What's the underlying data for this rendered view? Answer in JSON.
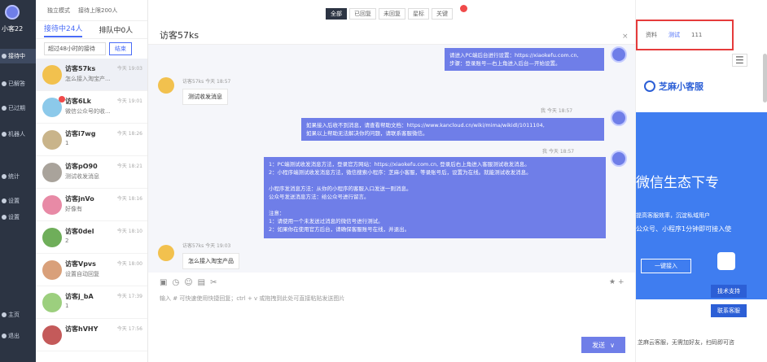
{
  "nav": {
    "user": "小客22",
    "items": [
      {
        "label": "接待中",
        "active": true
      },
      {
        "label": "已解答"
      },
      {
        "label": "已过期"
      },
      {
        "label": "机器人"
      },
      {
        "label": "统计"
      },
      {
        "label": "设置"
      },
      {
        "label": "设置"
      },
      {
        "label": "主页"
      },
      {
        "label": "退出"
      }
    ]
  },
  "list": {
    "top_mode": "独立模式",
    "top_limit": "接待上限200人",
    "tab_receiving": "接待中24人",
    "tab_queue": "排队中0人",
    "filter_select": "超过48小时的接待",
    "filter_btn": "结束",
    "conversations": [
      {
        "name": "访客57ks",
        "time": "今天 19:03",
        "msg": "怎么接入淘宝产..."
      },
      {
        "name": "访客6Lk",
        "time": "今天 19:01",
        "msg": "微信公众号的收..."
      },
      {
        "name": "访客i7wg",
        "time": "今天 18:26",
        "msg": "1"
      },
      {
        "name": "访客pO90",
        "time": "今天 18:21",
        "msg": "测试收发消息"
      },
      {
        "name": "访客jnVo",
        "time": "今天 18:16",
        "msg": "好像有"
      },
      {
        "name": "访客0del",
        "time": "今天 18:10",
        "msg": "2"
      },
      {
        "name": "访客Vpvs",
        "time": "今天 18:00",
        "msg": "设置自动回复"
      },
      {
        "name": "访客j_bA",
        "time": "今天 17:39",
        "msg": "1"
      },
      {
        "name": "访客hVHY",
        "time": "今天 17:56",
        "msg": ""
      }
    ]
  },
  "chat": {
    "filters": [
      "全部",
      "已回复",
      "未回复",
      "星标",
      "关键"
    ],
    "badge": "2",
    "title": "访客57ks",
    "close": "×",
    "messages": [
      {
        "type": "out",
        "text": "请进入PC端后台进行设置：https://xiaokefu.com.cn,\n步骤：登录账号—右上角进入后台—开始设置。"
      },
      {
        "type": "meta",
        "text": "访客57ks 今天 18:57"
      },
      {
        "type": "in",
        "text": "测试收发消息"
      },
      {
        "type": "meta",
        "text": "我 今天 18:57"
      },
      {
        "type": "out",
        "text": "如果接入后收不到消息，请查看帮助文档：https://www.kancloud.cn/wiki/mima/wikidl/1011104,\n如果以上帮助无法解决你的问题，请联系客服微信。"
      },
      {
        "type": "meta",
        "text": "我 今天 18:57"
      },
      {
        "type": "out",
        "text": "1：PC端测试收发消息方法，登录官方网站：https://xiaokefu.com.cn, 登录后右上角进入客服测试收发消息。\n2：小程序端测试收发消息方法，微信搜索小程序：芝麻小客服，等录账号后，设置为在线。就能测试收发消息。\n\n小程序发消息方法：从你的小程序的客服入口发送一则消息。\n公众号发送消息方法：给公众号进行留言。\n\n注意：\n1：请使用一个未发送过消息的微信号进行测试。\n2：如果你在使用官方后台，请确保客服账号在线，并退出。"
      },
      {
        "type": "meta",
        "text": "访客57ks 今天 19:03"
      },
      {
        "type": "in",
        "text": "怎么接入淘宝产品"
      }
    ],
    "hint": "输入 # 可快速使用快捷回复；ctrl + v 或拖拽到此处可直接粘贴发送图片",
    "send": "发送",
    "send_arrow": "∨"
  },
  "right": {
    "tabs": [
      "资料",
      "测试",
      "111"
    ],
    "menu": "☰",
    "brand": "芝麻小客服",
    "hero_title": "微信生态下专",
    "hero_sub": "提高客服效率，沉淀私域用户",
    "hero_sub2": "公众号、小程序1分钟即可接入使",
    "join": "一键接入",
    "btn_support": "技术支持",
    "btn_contact": "联系客服",
    "footer": "芝麻云客服，无需加好友，扫码即可咨"
  }
}
